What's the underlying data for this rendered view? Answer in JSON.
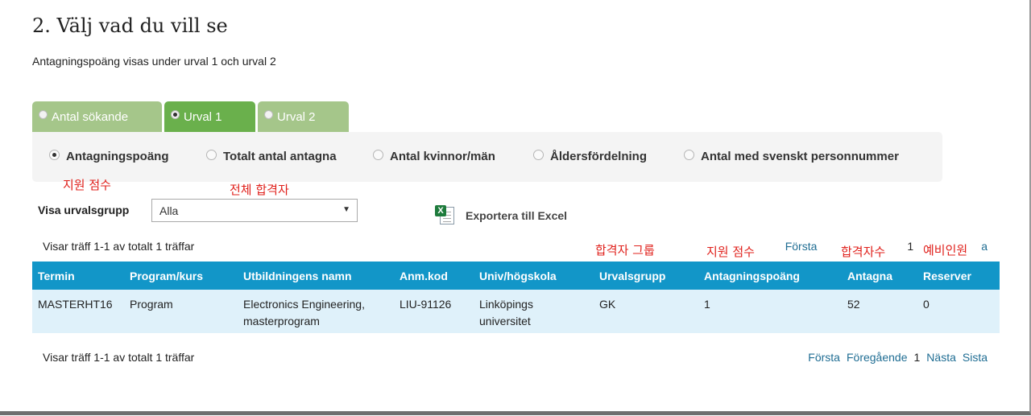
{
  "heading": "2. Välj vad du vill se",
  "subtitle": "Antagningspoäng visas under urval 1 och urval 2",
  "tabs": [
    {
      "label": "Antal sökande",
      "selected": false
    },
    {
      "label": "Urval 1",
      "selected": true
    },
    {
      "label": "Urval 2",
      "selected": false
    }
  ],
  "options": [
    {
      "label": "Antagningspoäng",
      "selected": true
    },
    {
      "label": "Totalt antal antagna",
      "selected": false
    },
    {
      "label": "Antal kvinnor/män",
      "selected": false
    },
    {
      "label": "Åldersfördelning",
      "selected": false
    },
    {
      "label": "Antal med svenskt personnummer",
      "selected": false
    }
  ],
  "annotations": {
    "a1": "지원 점수",
    "a2": "전체 합격자",
    "a3": "합격자 그룹",
    "a4": "지원 점수",
    "a5": "합격자수",
    "a6": "예비인원"
  },
  "filter": {
    "label": "Visa urvalsgrupp",
    "value": "Alla"
  },
  "export": {
    "label": "Exportera till Excel",
    "icon": "excel-icon"
  },
  "results": {
    "count_text": "Visar träff 1-1 av totalt 1 träffar",
    "pager_top": {
      "first": "Första",
      "page": "1",
      "last": "a"
    },
    "pager_bottom": {
      "first": "Första",
      "prev": "Föregående",
      "page": "1",
      "next": "Nästa",
      "last": "Sista"
    }
  },
  "table": {
    "headers": [
      "Termin",
      "Program/kurs",
      "Utbildningens namn",
      "Anm.kod",
      "Univ/högskola",
      "Urvalsgrupp",
      "Antagningspoäng",
      "Antagna",
      "Reserver"
    ],
    "rows": [
      [
        "MASTERHT16",
        "Program",
        "Electronics Engineering, masterprogram",
        "LIU-91126",
        "Linköpings universitet",
        "GK",
        "1",
        "52",
        "0"
      ]
    ]
  },
  "colors": {
    "tab_active": "#6ab04c",
    "tab_inactive": "#a5c68a",
    "table_header": "#1296c8",
    "row_bg": "#dff1fa",
    "link": "#1f6d93",
    "annotation": "#e0201b"
  }
}
